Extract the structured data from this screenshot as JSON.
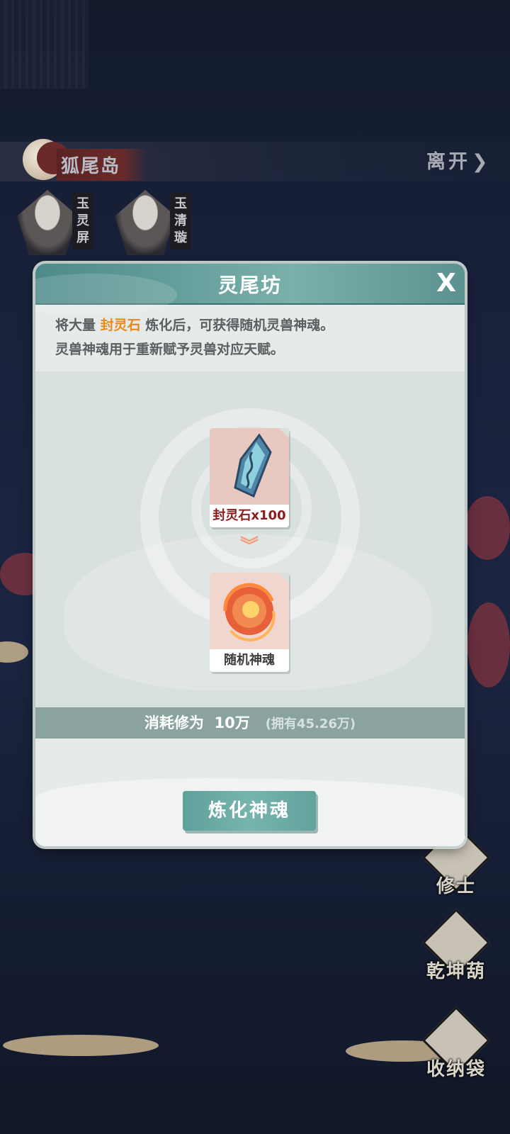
{
  "location": {
    "name": "狐尾岛",
    "leave_label": "离开"
  },
  "characters": [
    {
      "name": "玉灵屏"
    },
    {
      "name": "玉清璇"
    }
  ],
  "side_buttons": [
    {
      "label": "修士"
    },
    {
      "label": "乾坤葫"
    },
    {
      "label": "收纳袋"
    }
  ],
  "modal": {
    "title": "灵尾坊",
    "close_label": "X",
    "description": {
      "line1_prefix": "将大量 ",
      "line1_highlight": "封灵石",
      "line1_suffix": " 炼化后，可获得随机灵兽神魂。",
      "line2": "灵兽神魂用于重新赋予灵兽对应天赋。"
    },
    "source_item": {
      "label": "封灵石x100"
    },
    "result_item": {
      "label": "随机神魂"
    },
    "arrow_icon": "double-chevron-down-icon",
    "cost": {
      "label": "消耗修为",
      "amount": "10万",
      "owned": "(拥有45.26万)"
    },
    "refine_button_label": "炼化神魂"
  },
  "colors": {
    "header_teal": "#6aa39f",
    "highlight_orange": "#e68a1c",
    "source_label_red": "#8b1c1c"
  }
}
